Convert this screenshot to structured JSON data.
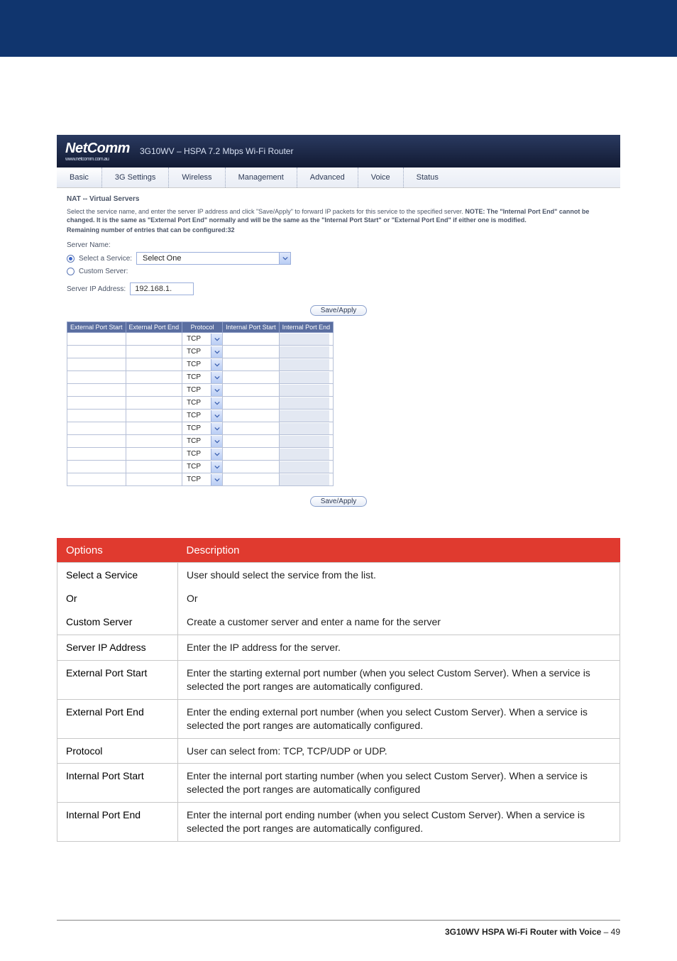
{
  "header": {
    "band_color": "#10356e"
  },
  "screenshot": {
    "logo": "NetComm",
    "logo_sub": "www.netcomm.com.au",
    "product_title": "3G10WV – HSPA 7.2 Mbps Wi-Fi Router",
    "nav": [
      "Basic",
      "3G Settings",
      "Wireless",
      "Management",
      "Advanced",
      "Voice",
      "Status"
    ],
    "crumb": "NAT -- Virtual Servers",
    "help_text_1": "Select the service name, and enter the server IP address and click \"Save/Apply\" to forward IP packets for this service to the specified server. ",
    "help_note_label": "NOTE: ",
    "help_text_2": "The \"Internal Port End\" cannot be changed. It is the same as \"External Port End\" normally and will be the same as the \"Internal Port Start\" or \"External Port End\" if either one is modified.",
    "remaining_label": "Remaining number of entries that can be configured:32",
    "server_name_label": "Server Name:",
    "select_service_label": "Select a Service:",
    "select_service_value": "Select One",
    "custom_server_label": "Custom Server:",
    "server_ip_label": "Server IP Address:",
    "server_ip_value": "192.168.1.",
    "save_apply": "Save/Apply",
    "port_headers": [
      "External Port Start",
      "External Port End",
      "Protocol",
      "Internal Port Start",
      "Internal Port End"
    ],
    "protocol_value": "TCP",
    "port_row_count": 12
  },
  "desc_table": {
    "header_options": "Options",
    "header_desc": "Description",
    "r1_opt_a": "Select a Service",
    "r1_opt_b": "Or",
    "r1_opt_c": "Custom Server",
    "r1_d_a": "User should select the service from the list.",
    "r1_d_b": "Or",
    "r1_d_c": "Create a customer server and enter a name for the server",
    "r2_opt": "Server IP Address",
    "r2_d": "Enter the IP address for the server.",
    "r3_opt": "External Port Start",
    "r3_d": "Enter the starting external port number (when you select Custom Server). When a service is selected the port ranges are automatically configured.",
    "r4_opt": "External Port End",
    "r4_d": "Enter the ending external port number (when you select Custom Server). When a service is selected the port ranges are automatically configured.",
    "r5_opt": "Protocol",
    "r5_d": "User can select from: TCP, TCP/UDP or UDP.",
    "r6_opt": "Internal Port Start",
    "r6_d": "Enter the internal port starting number (when you select Custom Server). When a service is selected the port ranges are automatically configured",
    "r7_opt": "Internal Port End",
    "r7_d": "Enter the internal port ending number (when you select Custom Server). When a service is selected the port ranges are automatically configured."
  },
  "footer": {
    "text_strong": "3G10WV HSPA Wi-Fi Router with Voice",
    "sep": " – ",
    "page": "49"
  }
}
